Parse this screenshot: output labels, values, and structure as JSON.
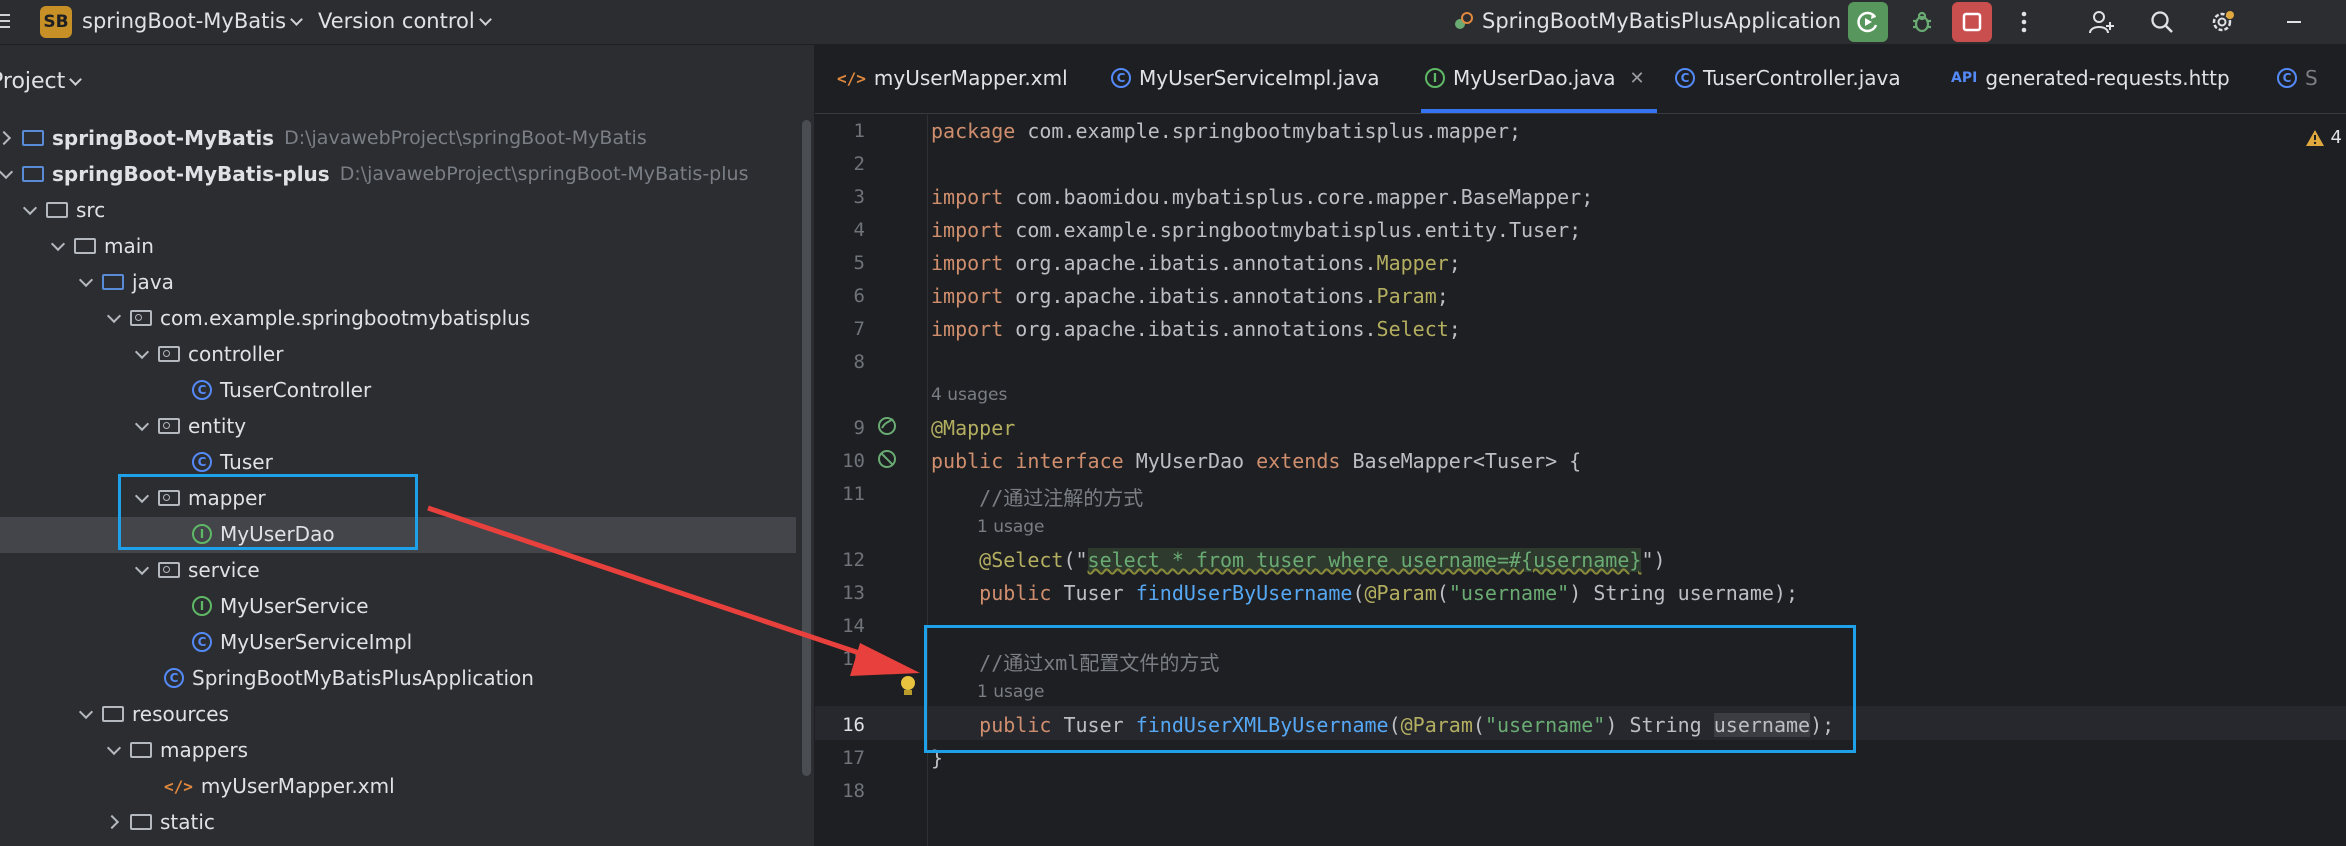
{
  "titlebar": {
    "project_badge": "SB",
    "project_name": "springBoot-MyBatis",
    "version_control": "Version control",
    "run_config": "SpringBootMyBatisPlusApplication"
  },
  "sidebar": {
    "title": "Project",
    "nodes": [
      {
        "label": "springBoot-MyBatis",
        "hint": "D:\\javawebProject\\springBoot-MyBatis"
      },
      {
        "label": "springBoot-MyBatis-plus",
        "hint": "D:\\javawebProject\\springBoot-MyBatis-plus"
      },
      {
        "label": "src"
      },
      {
        "label": "main"
      },
      {
        "label": "java"
      },
      {
        "label": "com.example.springbootmybatisplus"
      },
      {
        "label": "controller"
      },
      {
        "label": "TuserController"
      },
      {
        "label": "entity"
      },
      {
        "label": "Tuser"
      },
      {
        "label": "mapper"
      },
      {
        "label": "MyUserDao"
      },
      {
        "label": "service"
      },
      {
        "label": "MyUserService"
      },
      {
        "label": "MyUserServiceImpl"
      },
      {
        "label": "SpringBootMyBatisPlusApplication"
      },
      {
        "label": "resources"
      },
      {
        "label": "mappers"
      },
      {
        "label": "myUserMapper.xml"
      },
      {
        "label": "static"
      }
    ]
  },
  "editor": {
    "tabs": [
      {
        "label": "myUserMapper.xml"
      },
      {
        "label": "MyUserServiceImpl.java"
      },
      {
        "label": "MyUserDao.java"
      },
      {
        "label": "TuserController.java"
      },
      {
        "label": "generated-requests.http"
      },
      {
        "label": "S"
      }
    ],
    "warning_count": "4",
    "line_numbers": [
      "1",
      "2",
      "3",
      "4",
      "5",
      "6",
      "7",
      "8",
      "9",
      "10",
      "11",
      "12",
      "13",
      "14",
      "15",
      "16",
      "17",
      "18"
    ],
    "hints": {
      "usages_4": "4 usages",
      "usage_1a": "1 usage",
      "usage_1b": "1 usage"
    },
    "code": {
      "l1_kw": "package",
      "l1_rest": " com.example.springbootmybatisplus.mapper;",
      "l3_kw": "import",
      "l3_rest": " com.baomidou.mybatisplus.core.mapper.BaseMapper;",
      "l4_kw": "import",
      "l4_rest": " com.example.springbootmybatisplus.entity.Tuser;",
      "l5_kw": "import",
      "l5_pre": " org.apache.ibatis.annotations.",
      "l5_ann": "Mapper",
      "l5_end": ";",
      "l6_kw": "import",
      "l6_pre": " org.apache.ibatis.annotations.",
      "l6_ann": "Param",
      "l6_end": ";",
      "l7_kw": "import",
      "l7_pre": " org.apache.ibatis.annotations.",
      "l7_ann": "Select",
      "l7_end": ";",
      "l9_ann": "@Mapper",
      "l10_kw1": "public interface",
      "l10_name": " MyUserDao ",
      "l10_kw2": "extends",
      "l10_rest": " BaseMapper<Tuser> {",
      "l11_cm": "    //通过注解的方式",
      "l12_ann": "    @Select",
      "l12_p": "(\"",
      "l12_sql": "select * from tuser where username=#{username}",
      "l12_end": "\")",
      "l13_kw": "    public",
      "l13_type": " Tuser ",
      "l13_fn": "findUserByUsername",
      "l13_p1": "(",
      "l13_ann": "@Param",
      "l13_p2": "(",
      "l13_str": "\"username\"",
      "l13_rest": ") String username);",
      "l15_cm": "    //通过xml配置文件的方式",
      "l16_kw": "    public",
      "l16_type": " Tuser ",
      "l16_fn": "findUserXMLByUsername",
      "l16_p1": "(",
      "l16_ann": "@Param",
      "l16_p2": "(",
      "l16_str": "\"username\"",
      "l16_mid": ") String ",
      "l16_sel": "username",
      "l16_end": ");",
      "l17": "}"
    }
  },
  "colors": {
    "accent": "#3574f0",
    "highlight_box": "#1ea1e8",
    "arrow": "#e8403c"
  }
}
